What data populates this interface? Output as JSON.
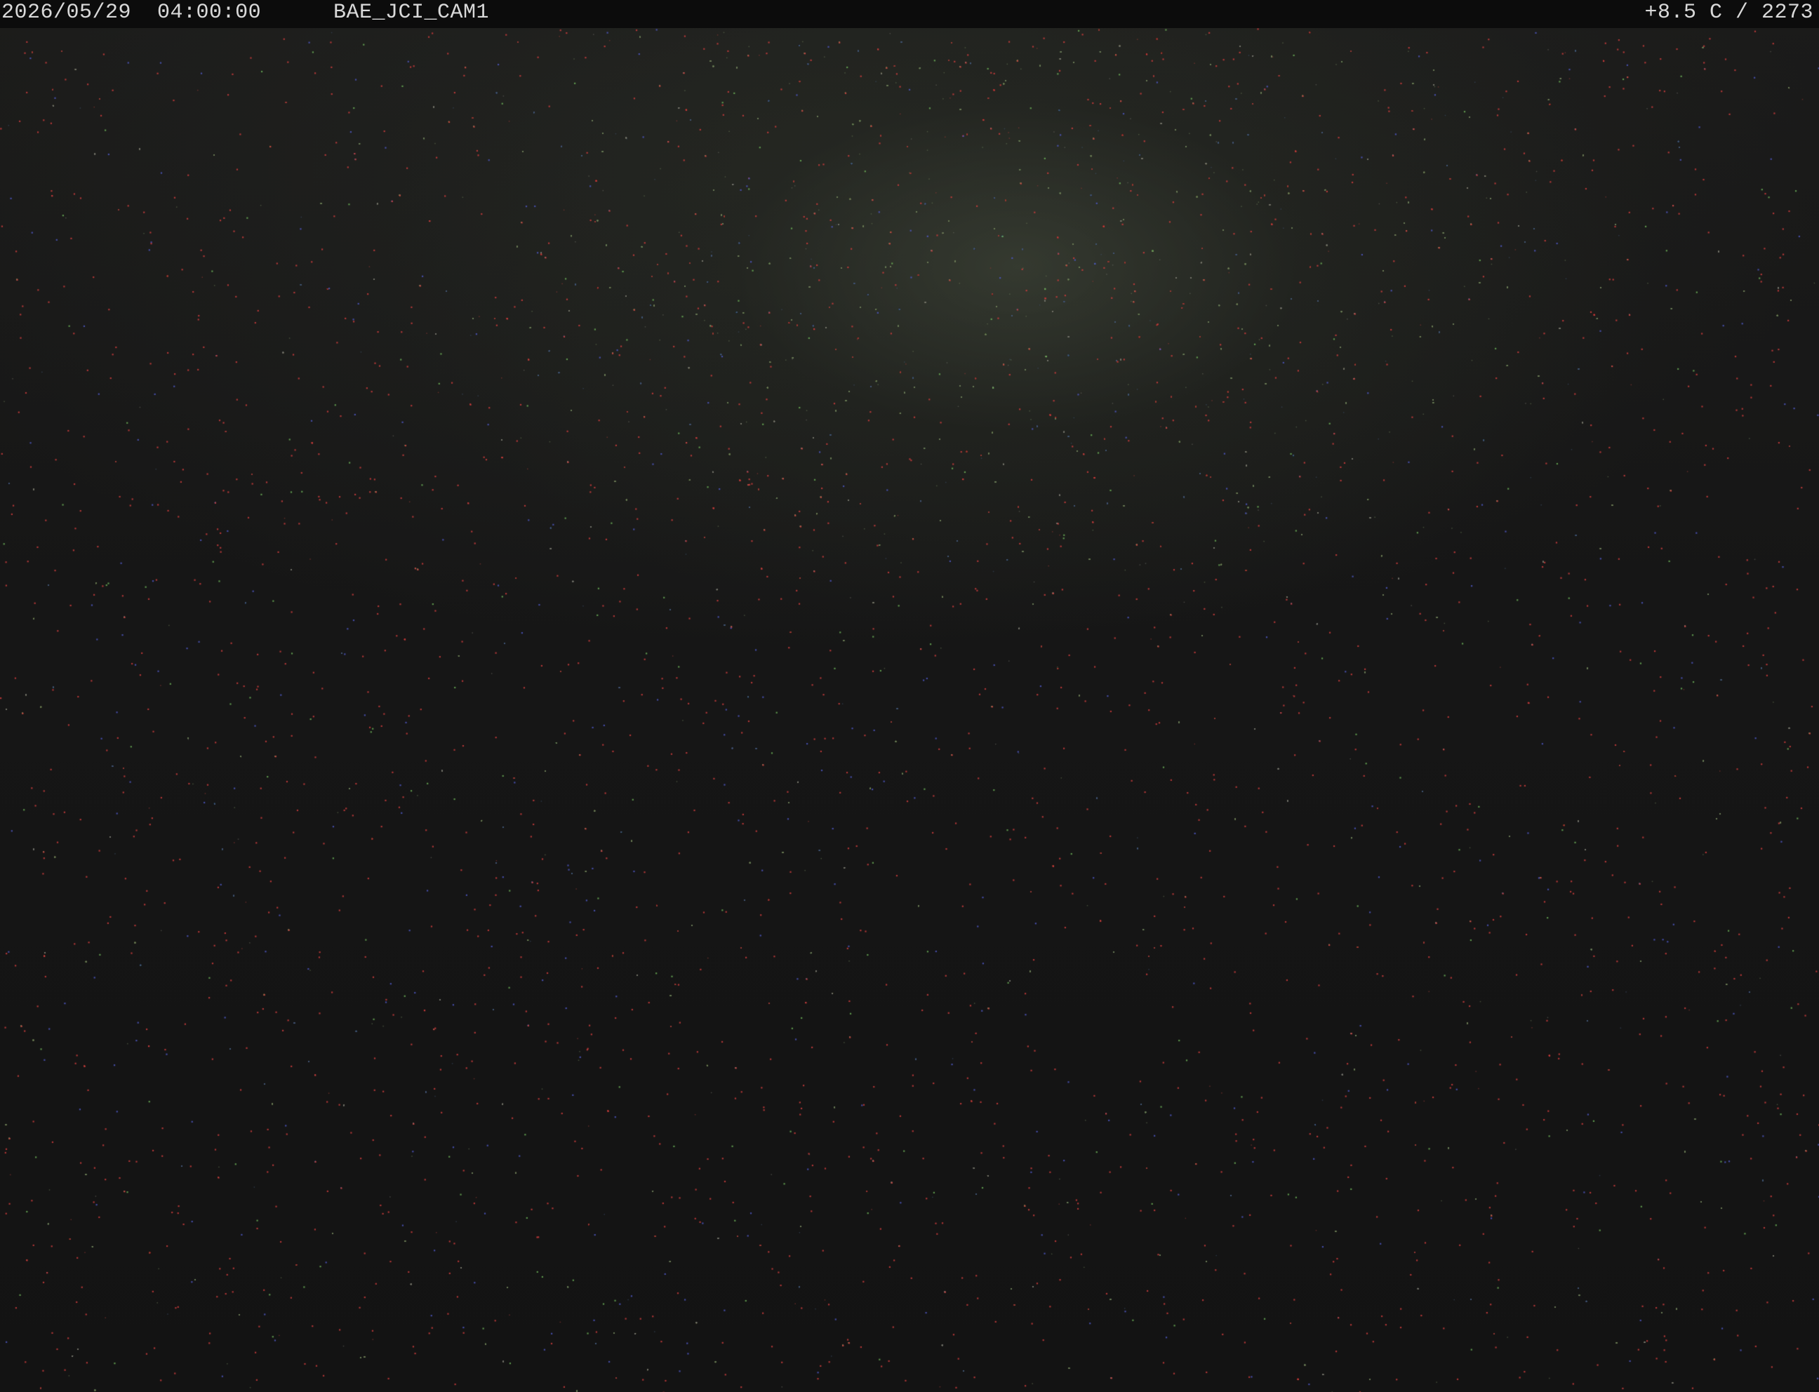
{
  "overlay": {
    "date": "2026/05/29",
    "time": "04:00:00",
    "camera_id": "BAE_JCI_CAM1",
    "readout": "+8.5 C / 2273"
  },
  "colors": {
    "sky_glow": "#46504a",
    "background": "#141414",
    "osd_bar": "#0c0c0c",
    "osd_text": "#d9d9d9"
  }
}
